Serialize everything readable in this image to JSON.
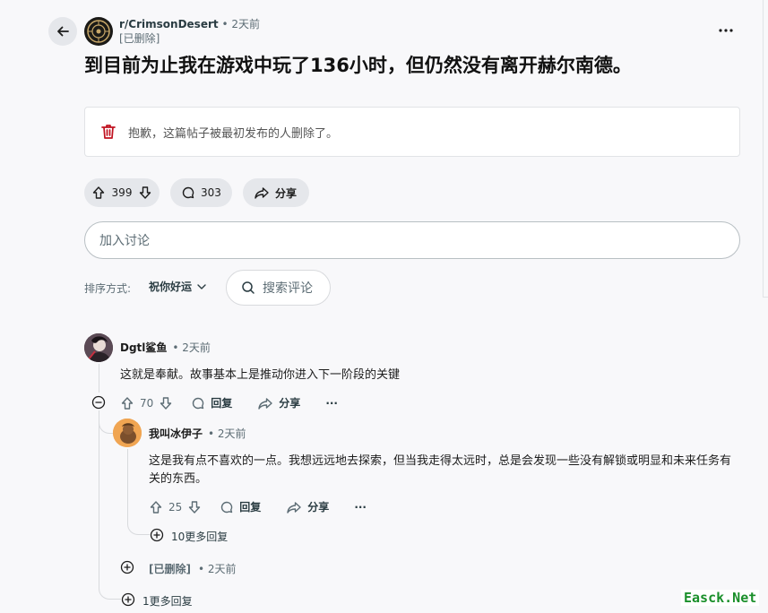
{
  "post": {
    "subreddit": "r/CrimsonDesert",
    "time": "• 2天前",
    "author": "[已删除]",
    "title": "到目前为止我在游戏中玩了136小时，但仍然没有离开赫尔南德。",
    "deleted_notice": "抱歉，这篇帖子被最初发布的人删除了。",
    "votes": "399",
    "comments": "303",
    "share_label": "分享"
  },
  "join": {
    "placeholder": "加入讨论"
  },
  "sort": {
    "label": "排序方式:",
    "value": "祝你好运"
  },
  "search_comments": {
    "label": "搜索评论"
  },
  "comments": [
    {
      "author": "Dgtl鲨鱼",
      "time": "• 2天前",
      "body": "这就是奉献。故事基本上是推动你进入下一阶段的关键",
      "votes": "70",
      "reply_label": "回复",
      "share_label": "分享",
      "more": "···"
    },
    {
      "author": "我叫冰伊子",
      "time": "• 2天前",
      "body": "这是我有点不喜欢的一点。我想远远地去探索，但当我走得太远时，总是会发现一些没有解锁或明显和未来任务有关的东西。",
      "votes": "25",
      "reply_label": "回复",
      "share_label": "分享",
      "more": "···"
    }
  ],
  "more_replies_nested": "10更多回复",
  "deleted_reply": {
    "author": "[已删除]",
    "time": "• 2天前"
  },
  "more_replies_root": "1更多回复",
  "watermark": "Easck.Net"
}
